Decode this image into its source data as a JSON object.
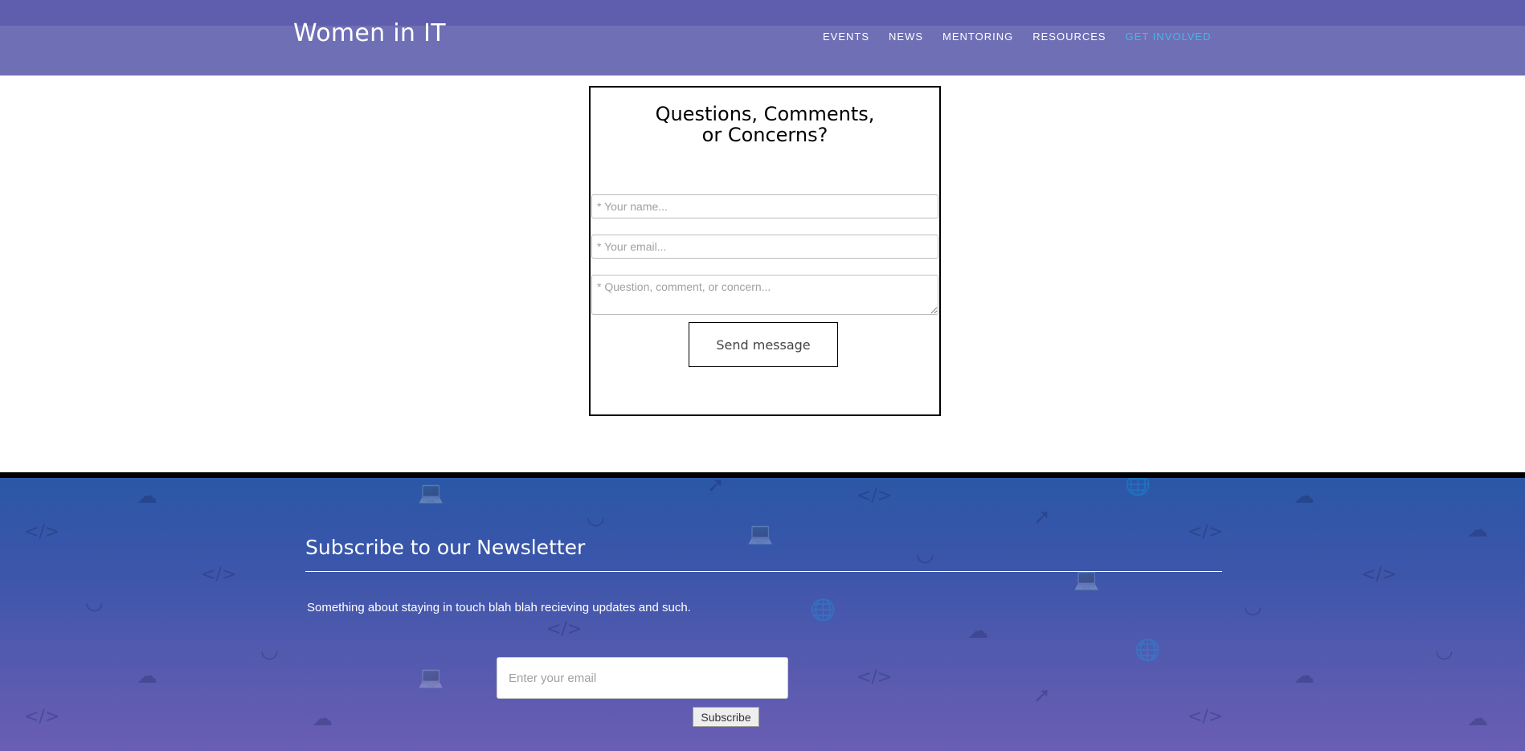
{
  "header": {
    "brand": "Women in IT",
    "nav": [
      {
        "label": "EVENTS",
        "active": false
      },
      {
        "label": "NEWS",
        "active": false
      },
      {
        "label": "MENTORING",
        "active": false
      },
      {
        "label": "RESOURCES",
        "active": false
      },
      {
        "label": "GET INVOLVED",
        "active": true
      }
    ]
  },
  "contact": {
    "title_line1": "Questions, Comments,",
    "title_line2": "or Concerns?",
    "name_placeholder": "* Your name...",
    "email_placeholder": "* Your email...",
    "message_placeholder": "* Question, comment, or concern...",
    "send_label": "Send message"
  },
  "newsletter": {
    "title": "Subscribe to our Newsletter",
    "text": "Something about staying in touch blah blah recieving updates and such.",
    "email_placeholder": "Enter your email",
    "subscribe_label": "Subscribe"
  },
  "colors": {
    "header_bg": "#6f6fb5",
    "active_nav": "#45b7e6",
    "footer_top": "#2b57a7",
    "footer_bottom": "#6a5eb4"
  }
}
